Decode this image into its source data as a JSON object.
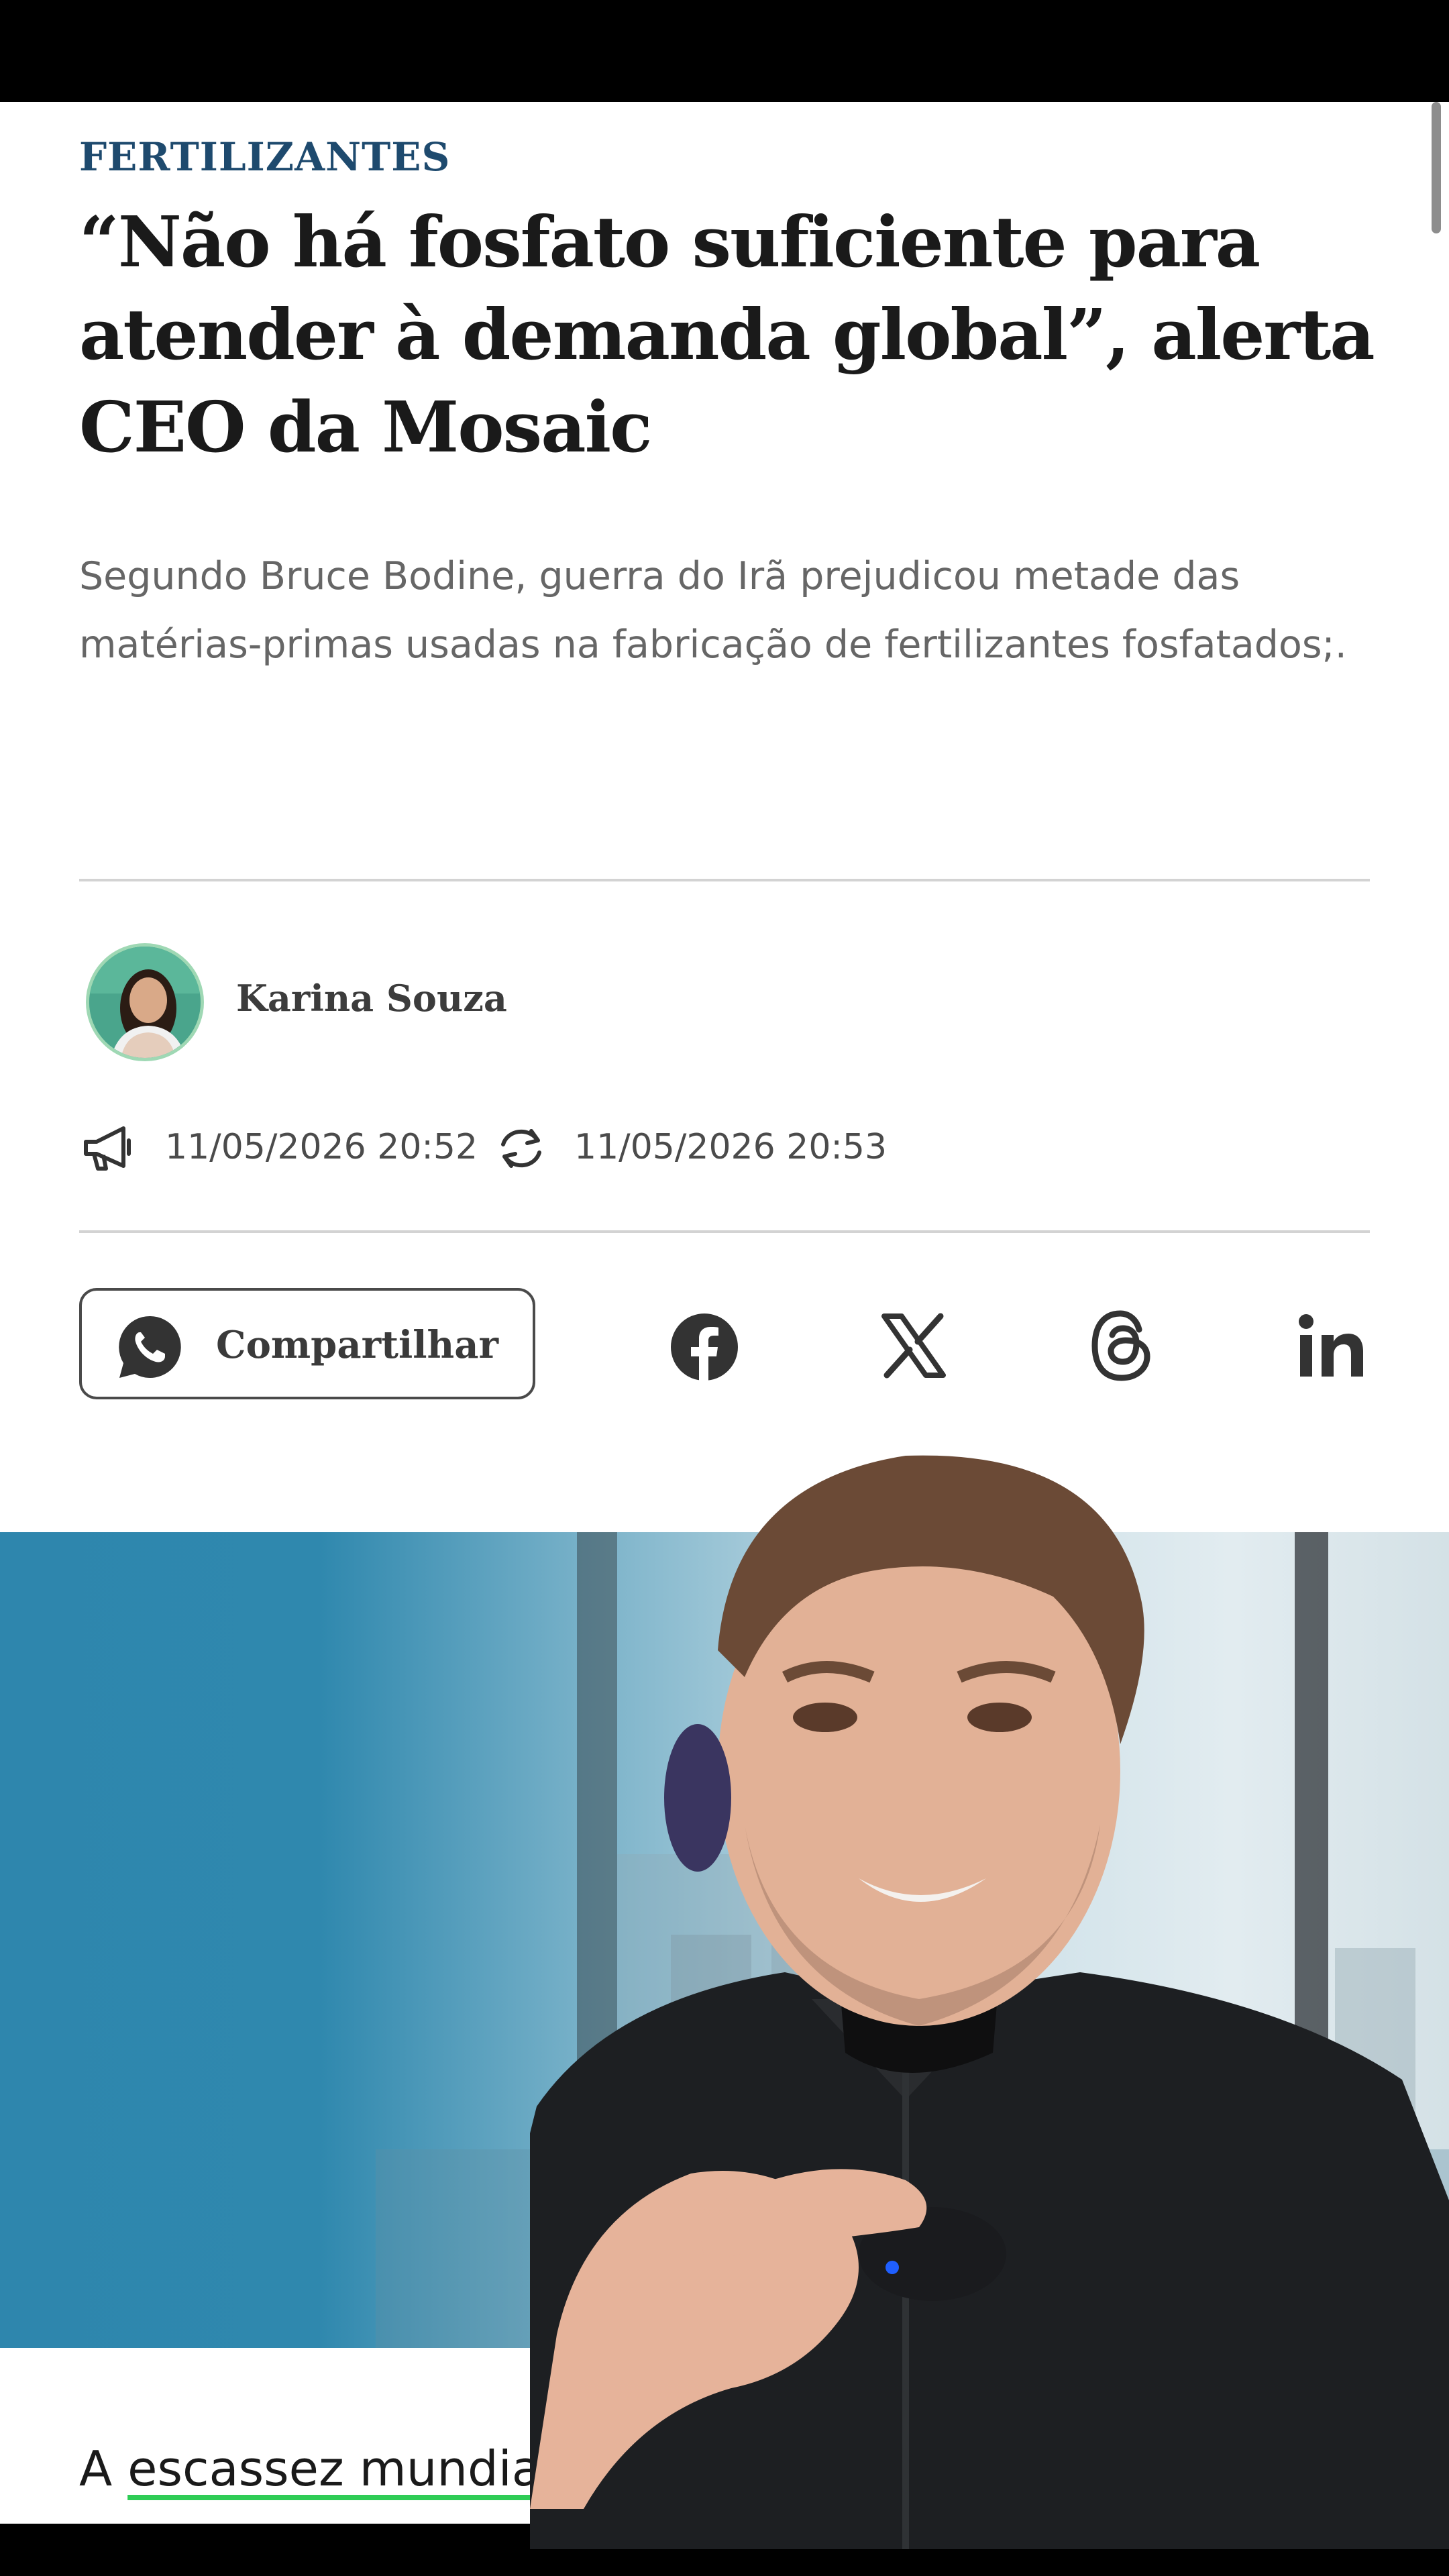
{
  "article": {
    "kicker": "FERTILIZANTES",
    "headline": "“Não há fosfato suficiente para atender à demanda global”, alerta CEO da Mosaic",
    "dek": "Segundo Bruce Bodine, guerra do Irã prejudicou metade das matérias-primas usadas na fabricação de fertilizantes fosfatados;.",
    "author": "Karina Souza",
    "published": "11/05/2026 20:52",
    "updated": "11/05/2026 20:53",
    "share_label": "Compartilhar",
    "body_prefix": "A ",
    "body_link": "escassez mundial"
  },
  "icons": {
    "published": "megaphone-icon",
    "updated": "refresh-icon",
    "whatsapp": "whatsapp-icon",
    "facebook": "facebook-icon",
    "x": "x-icon",
    "threads": "threads-icon",
    "linkedin": "linkedin-icon"
  },
  "colors": {
    "kicker": "#1e4a6e",
    "headline": "#1a1a1a",
    "dek": "#666666",
    "link_underline": "#2ecc55",
    "hero_blue": "#2e86ad"
  }
}
